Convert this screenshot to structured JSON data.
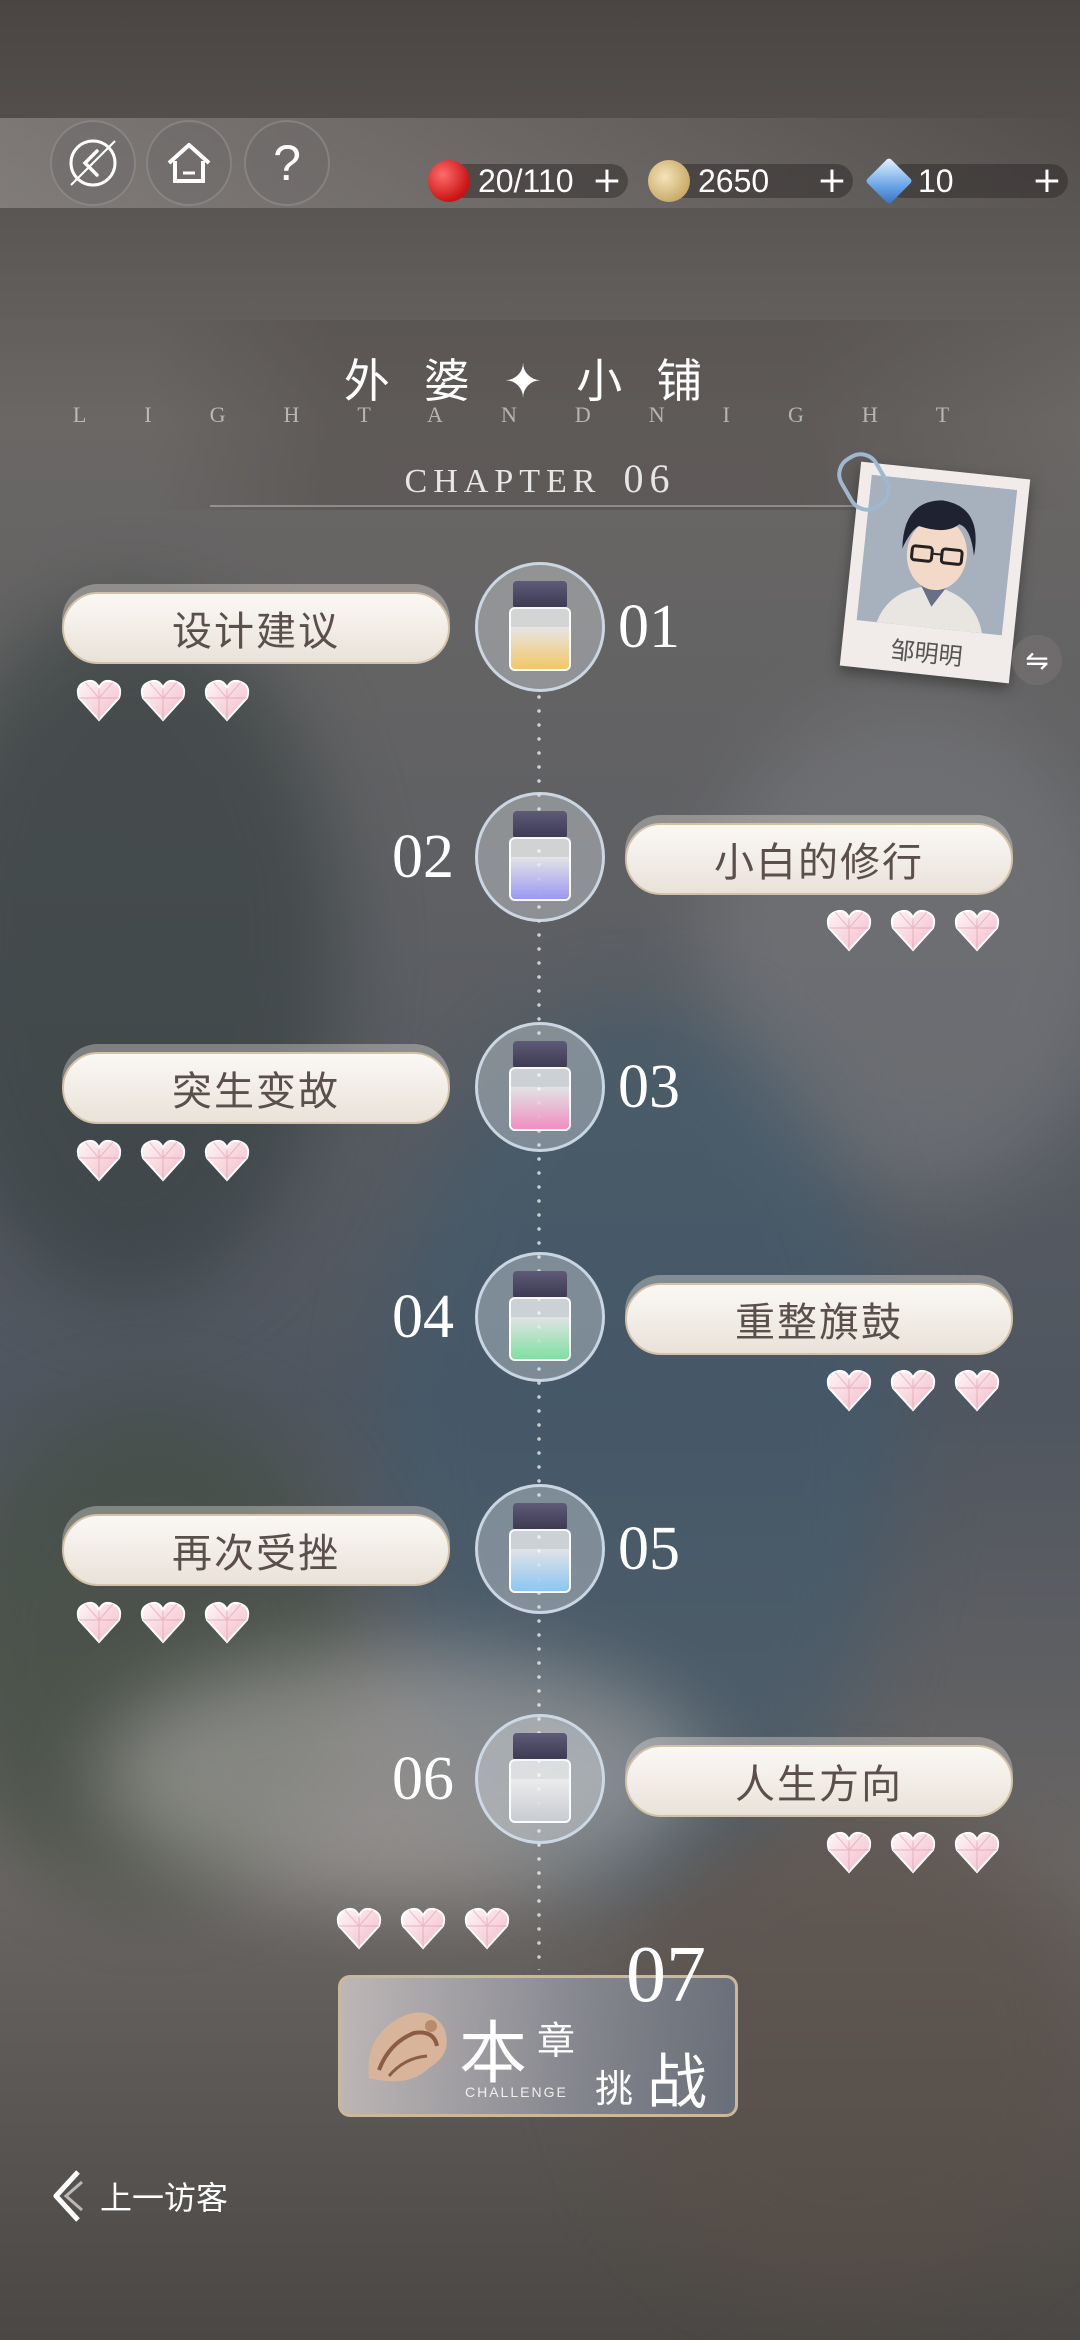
{
  "resources": {
    "stamina": {
      "icon": "red-apple-icon",
      "value": "20/110",
      "plus": "+"
    },
    "coins": {
      "icon": "gold-coin-icon",
      "value": "2650",
      "plus": "+"
    },
    "diamonds": {
      "icon": "diamond-icon",
      "value": "10",
      "plus": "+"
    }
  },
  "header": {
    "help_label": "?",
    "chapter_name": "外婆✦小铺",
    "subtitle": "LIGHTANDNIGHT",
    "chapter_word": "CHAPTER",
    "chapter_number": "06"
  },
  "character": {
    "name": "邹明明",
    "switch_label": "⇋"
  },
  "stages": [
    {
      "number": "01",
      "title": "设计建议",
      "liquid_color": "#f3c766",
      "hearts": 3
    },
    {
      "number": "02",
      "title": "小白的修行",
      "liquid_color": "#9c98f2",
      "hearts": 3
    },
    {
      "number": "03",
      "title": "突生变故",
      "liquid_color": "#f08ec0",
      "hearts": 3
    },
    {
      "number": "04",
      "title": "重整旗鼓",
      "liquid_color": "#7fe0a0",
      "hearts": 3
    },
    {
      "number": "05",
      "title": "再次受挫",
      "liquid_color": "#8cc6f2",
      "hearts": 3
    },
    {
      "number": "06",
      "title": "人生方向",
      "liquid_color": "#c9ccd2",
      "hearts": 3
    }
  ],
  "challenge": {
    "number": "07",
    "chars": [
      "本",
      "章",
      "挑",
      "战"
    ],
    "english": "CHALLENGE",
    "hearts": 3
  },
  "footer": {
    "prev_label": "上一访客"
  }
}
